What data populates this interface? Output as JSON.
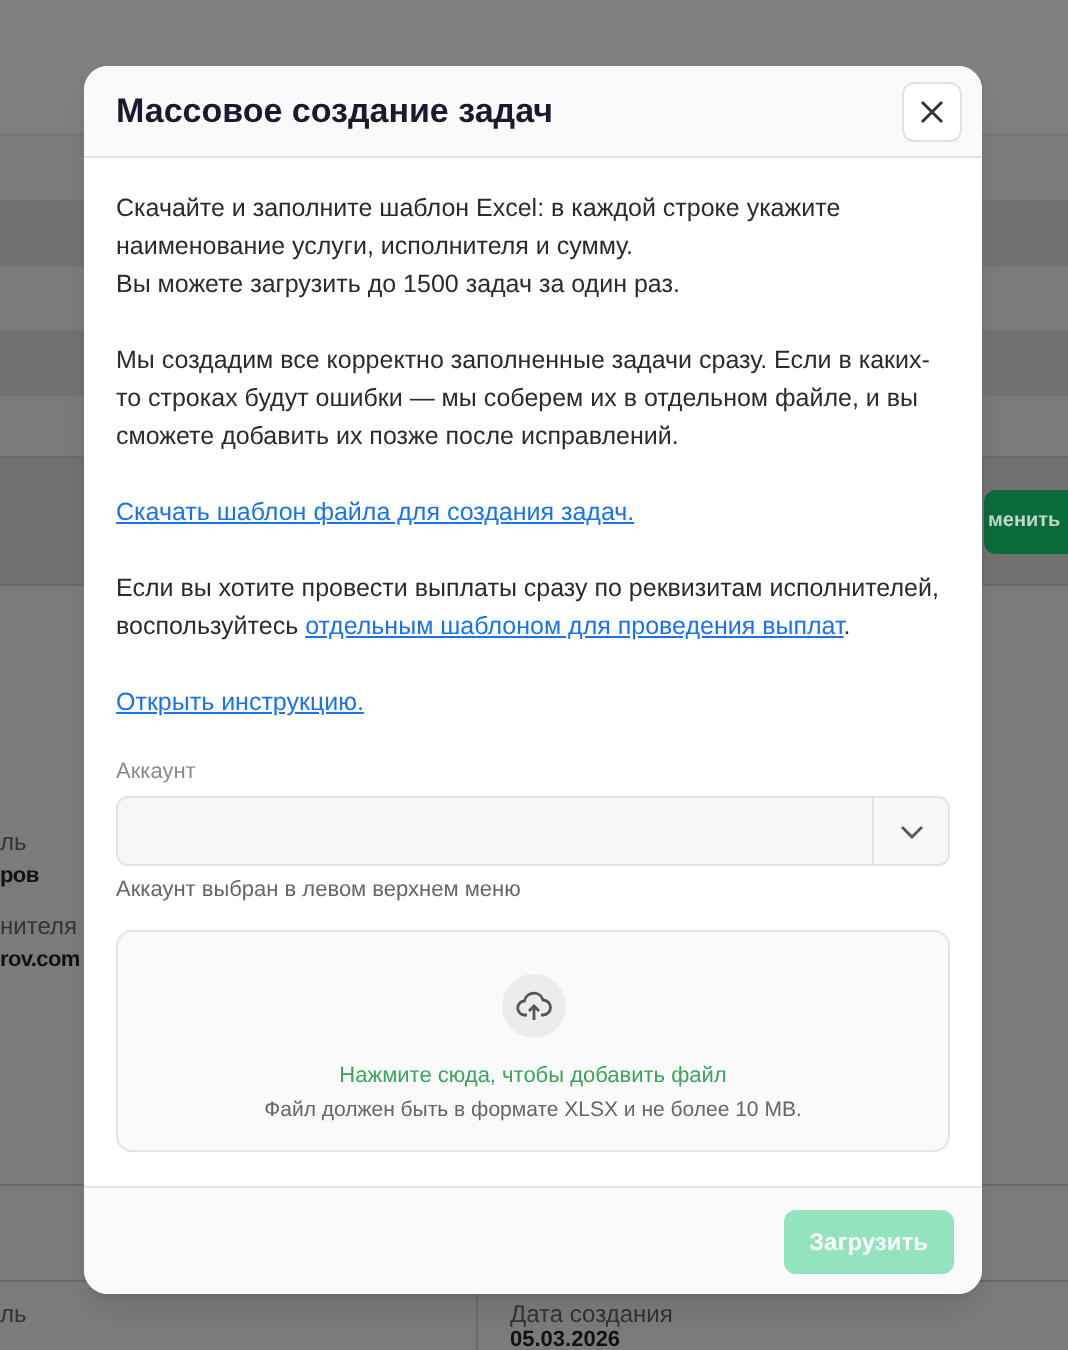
{
  "background": {
    "action_button": "менить",
    "fields": [
      {
        "label": "ль",
        "value": "ров"
      },
      {
        "label": "нителя",
        "value": "rov.com"
      }
    ],
    "bottom_fields": [
      {
        "label": "ль"
      },
      {
        "label": "Дата создания",
        "value": "05.03.2026"
      }
    ]
  },
  "dialog": {
    "title": "Массовое создание задач",
    "intro_lines": [
      "Скачайте и заполните шаблон Excel: в каждой строке укажите наименование услуги, исполнителя и сумму.",
      "Вы можете загрузить до 1500 задач за один раз."
    ],
    "errors_note": "Мы создадим все корректно заполненные задачи сразу. Если в каких-то строках будут ошибки — мы соберем их в отдельном файле, и вы сможете добавить их позже после исправлений.",
    "template_link": "Скачать шаблон файла для создания задач.",
    "payout_note": {
      "before": "Если вы хотите провести выплаты сразу по реквизитам исполнителей, воспользуйтесь ",
      "link": "отдельным шаблоном для проведения выплат",
      "after": "."
    },
    "instruction_link": "Открыть инструкцию.",
    "account": {
      "label": "Аккаунт",
      "hint": "Аккаунт выбран в левом верхнем меню"
    },
    "dropzone": {
      "action": "Нажмите сюда, чтобы добавить файл",
      "hint": "Файл должен быть в формате XLSX и не более 10 MB."
    },
    "submit": {
      "label": "Загрузить",
      "disabled": true
    }
  }
}
